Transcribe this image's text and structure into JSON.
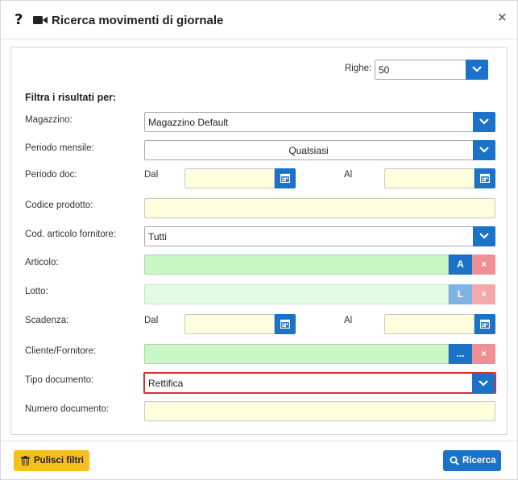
{
  "dialog": {
    "title": "Ricerca movimenti di giornale",
    "help_icon": "?",
    "close_icon": "×"
  },
  "rows_selector": {
    "label": "Righe:",
    "value": "50"
  },
  "filters": {
    "section_title": "Filtra i risultati per:",
    "magazzino": {
      "label": "Magazzino:",
      "value": "Magazzino Default"
    },
    "periodo_mensile": {
      "label": "Periodo mensile:",
      "value": "Qualsiasi"
    },
    "periodo_doc": {
      "label": "Periodo doc:",
      "from_label": "Dal",
      "to_label": "Al",
      "from_value": "",
      "to_value": ""
    },
    "codice_prodotto": {
      "label": "Codice prodotto:",
      "value": ""
    },
    "cod_articolo_fornitore": {
      "label": "Cod. articolo fornitore:",
      "value": "Tutti"
    },
    "articolo": {
      "label": "Articolo:",
      "value": "",
      "button": "A",
      "clear": "×"
    },
    "lotto": {
      "label": "Lotto:",
      "value": "",
      "button": "L",
      "clear": "×"
    },
    "scadenza": {
      "label": "Scadenza:",
      "from_label": "Dal",
      "to_label": "Al",
      "from_value": "",
      "to_value": ""
    },
    "cliente_fornitore": {
      "label": "Cliente/Fornitore:",
      "value": "",
      "button": "...",
      "clear": "×"
    },
    "tipo_documento": {
      "label": "Tipo documento:",
      "value": "Rettifica"
    },
    "numero_documento": {
      "label": "Numero documento:",
      "value": ""
    }
  },
  "footer": {
    "clear_button": "Pulisci filtri",
    "search_button": "Ricerca"
  },
  "colors": {
    "primary": "#1a73c9",
    "warning": "#f7bf1e",
    "input_yellow": "#ffffdd",
    "input_green": "#c9f7c6",
    "danger_light": "#ee8f93",
    "highlight": "#d9302c"
  }
}
